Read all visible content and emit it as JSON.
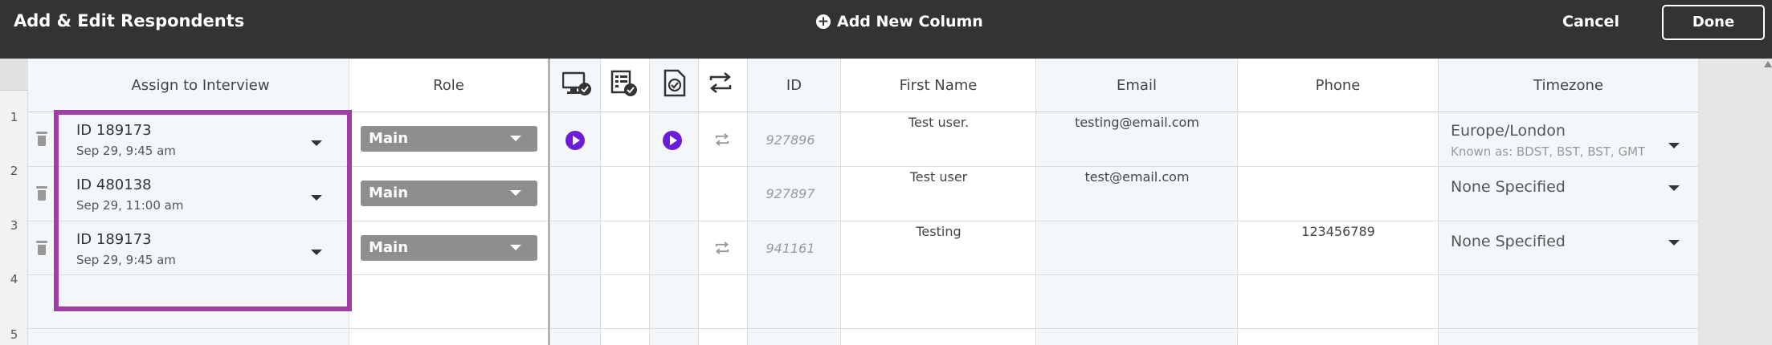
{
  "topbar": {
    "title": "Add & Edit Respondents",
    "add_column_label": "Add New Column",
    "cancel_label": "Cancel",
    "done_label": "Done"
  },
  "columns": {
    "assign": "Assign to Interview",
    "role": "Role",
    "icons": [
      "monitor-check-icon",
      "list-check-icon",
      "document-check-icon",
      "repeat-icon"
    ],
    "id": "ID",
    "first_name": "First Name",
    "email": "Email",
    "phone": "Phone",
    "timezone": "Timezone"
  },
  "row_numbers": [
    "1",
    "2",
    "3",
    "4",
    "5"
  ],
  "rows": [
    {
      "interview_id": "ID 189173",
      "interview_date": "Sep 29, 9:45 am",
      "role": "Main",
      "play1": true,
      "play2": true,
      "repeat": true,
      "id": "927896",
      "first_name": "Test user.",
      "email": "testing@email.com",
      "phone": "",
      "timezone": "Europe/London",
      "timezone_known": "Known as: BDST, BST, BST, GMT"
    },
    {
      "interview_id": "ID 480138",
      "interview_date": "Sep 29, 11:00 am",
      "role": "Main",
      "play1": false,
      "play2": false,
      "repeat": false,
      "id": "927897",
      "first_name": "Test user",
      "email": "test@email.com",
      "phone": "",
      "timezone": "None Specified",
      "timezone_known": ""
    },
    {
      "interview_id": "ID 189173",
      "interview_date": "Sep 29, 9:45 am",
      "role": "Main",
      "play1": false,
      "play2": false,
      "repeat": true,
      "id": "941161",
      "first_name": "Testing",
      "email": "",
      "phone": "123456789",
      "timezone": "None Specified",
      "timezone_known": ""
    }
  ],
  "colors": {
    "topbar": "#333333",
    "highlight": "#a13ea5",
    "play": "#6a1fd6",
    "role_box": "#8e8e8e"
  }
}
